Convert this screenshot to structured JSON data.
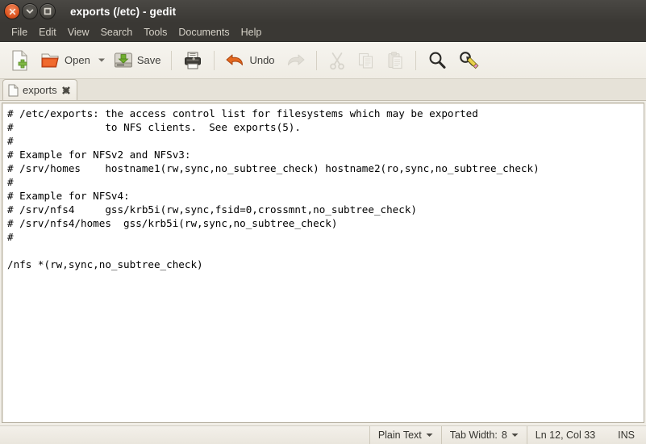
{
  "window": {
    "title": "exports (/etc) - gedit",
    "controls": [
      {
        "name": "close",
        "icon": "close-icon"
      },
      {
        "name": "minimize",
        "icon": "chevron-down-icon"
      },
      {
        "name": "maximize",
        "icon": "square-icon"
      }
    ]
  },
  "menu": {
    "items": [
      {
        "label": "File"
      },
      {
        "label": "Edit"
      },
      {
        "label": "View"
      },
      {
        "label": "Search"
      },
      {
        "label": "Tools"
      },
      {
        "label": "Documents"
      },
      {
        "label": "Help"
      }
    ]
  },
  "toolbar": {
    "new_label": "",
    "open_label": "Open",
    "save_label": "Save",
    "print_label": "",
    "undo_label": "Undo",
    "redo_label": "",
    "cut_label": "",
    "copy_label": "",
    "paste_label": "",
    "find_label": "",
    "replace_label": "",
    "icons": {
      "new": "new-document-icon",
      "open": "open-folder-icon",
      "open_dropdown": "chevron-down-icon",
      "save": "save-icon",
      "print": "print-icon",
      "undo": "undo-arrow-icon",
      "redo": "redo-arrow-icon",
      "cut": "scissors-icon",
      "copy": "copy-icon",
      "paste": "clipboard-icon",
      "find": "magnifier-icon",
      "replace": "find-replace-icon"
    }
  },
  "tabs": [
    {
      "label": "exports",
      "icon": "document-icon",
      "close_icon": "close-icon",
      "active": true
    }
  ],
  "document": {
    "filename": "exports",
    "content": "# /etc/exports: the access control list for filesystems which may be exported\n#\t\tto NFS clients.  See exports(5).\n#\n# Example for NFSv2 and NFSv3:\n# /srv/homes\thostname1(rw,sync,no_subtree_check) hostname2(ro,sync,no_subtree_check)\n#\n# Example for NFSv4:\n# /srv/nfs4\tgss/krb5i(rw,sync,fsid=0,crossmnt,no_subtree_check)\n# /srv/nfs4/homes  gss/krb5i(rw,sync,no_subtree_check)\n#\n\n/nfs *(rw,sync,no_subtree_check)"
  },
  "statusbar": {
    "language": "Plain Text",
    "tab_width_label": "Tab Width:",
    "tab_width_value": "8",
    "position": "Ln 12, Col 33",
    "insert_mode": "INS",
    "caret_icon": "chevron-down-icon"
  },
  "colors": {
    "titlebar": "#3a3834",
    "toolbar": "#f2efe9",
    "text_background": "#ffffff",
    "accent": "#dd5520"
  }
}
